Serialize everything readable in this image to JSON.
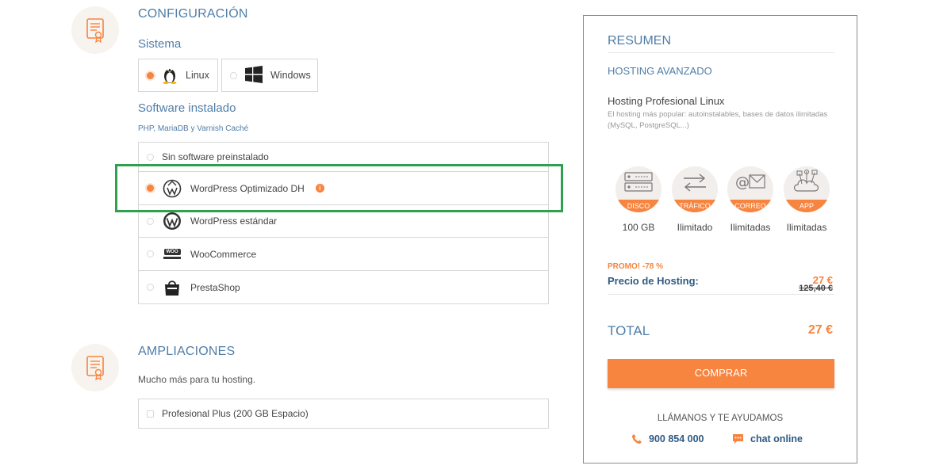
{
  "config": {
    "title": "CONFIGURACIÓN",
    "system_title": "Sistema",
    "os": [
      {
        "label": "Linux",
        "selected": true
      },
      {
        "label": "Windows",
        "selected": false
      }
    ],
    "software_title": "Software instalado",
    "software_sub": "PHP, MariaDB y Varnish Caché",
    "software": [
      {
        "label": "Sin software preinstalado",
        "selected": false
      },
      {
        "label": "WordPress Optimizado DH",
        "selected": true
      },
      {
        "label": "WordPress estándar",
        "selected": false
      },
      {
        "label": "WooCommerce",
        "selected": false
      },
      {
        "label": "PrestaShop",
        "selected": false
      }
    ],
    "woo_logo_text": "WOO"
  },
  "addons": {
    "title": "AMPLIACIONES",
    "subtitle": "Mucho más para tu hosting.",
    "items": [
      {
        "label": "Profesional Plus (200 GB Espacio)",
        "checked": false
      }
    ]
  },
  "summary": {
    "title": "RESUMEN",
    "plan": "HOSTING AVANZADO",
    "product": "Hosting Profesional Linux",
    "description": "El hosting más popular: autoinstalables, bases de datos ilimitadas (MySQL, PostgreSQL...)",
    "features": [
      {
        "band": "DISCO",
        "value": "100 GB",
        "icon": "server-icon"
      },
      {
        "band": "TRÁFICO",
        "value": "Ilimitado",
        "icon": "transfer-arrows-icon"
      },
      {
        "band": "CORREO",
        "value": "Ilimitadas",
        "icon": "mail-icon"
      },
      {
        "band": "APP",
        "value": "Ilimitadas",
        "icon": "apps-cloud-icon"
      }
    ],
    "promo": "PROMO! -78 %",
    "price_label": "Precio de Hosting:",
    "price": "27 €",
    "old_price": "125,40 €",
    "total_label": "TOTAL",
    "total": "27 €",
    "buy": "COMPRAR",
    "help": "LLÁMANOS Y TE AYUDAMOS",
    "phone": "900 854 000",
    "chat": "chat online"
  },
  "colors": {
    "accent": "#f7843f",
    "blue": "#4f7ea8",
    "highlight": "#2ea04f"
  }
}
